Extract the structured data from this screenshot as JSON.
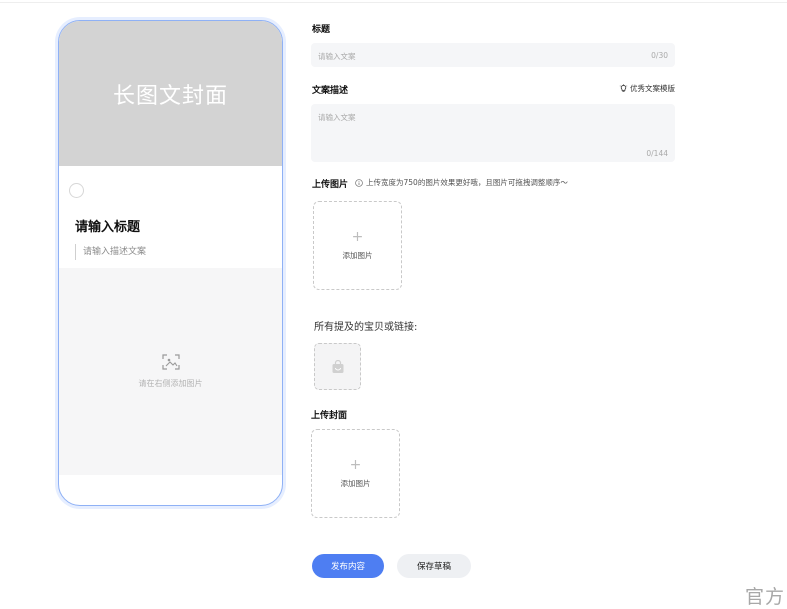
{
  "preview": {
    "cover_label": "长图文封面",
    "title_placeholder": "请输入标题",
    "desc_placeholder": "请输入描述文案",
    "image_hint": "请在右侧添加图片"
  },
  "form": {
    "title": {
      "label": "标题",
      "placeholder": "请输入文案",
      "counter": "0/30"
    },
    "description": {
      "label": "文案描述",
      "template_link": "优秀文案模版",
      "placeholder": "请输入文案",
      "counter": "0/144"
    },
    "upload_images": {
      "label": "上传图片",
      "hint": "上传宽度为750的图片效果更好哦，且图片可拖拽调整顺序～",
      "add_label": "添加图片",
      "plus": "+"
    },
    "goods": {
      "label": "所有提及的宝贝或链接:"
    },
    "upload_cover": {
      "label": "上传封面",
      "add_label": "添加图片",
      "plus": "+"
    }
  },
  "actions": {
    "publish_label": "发布内容",
    "save_draft_label": "保存草稿"
  },
  "watermark": "官方",
  "colors": {
    "accent": "#4e7ef2",
    "phone_border": "#8fb1f5",
    "cover_bg": "#d3d3d3",
    "input_bg": "#f5f6f8"
  },
  "icons": {
    "template": "lightbulb-icon",
    "upload_hint": "info-icon",
    "preview_image": "image-scan-icon",
    "goods": "shopping-bag-icon"
  }
}
